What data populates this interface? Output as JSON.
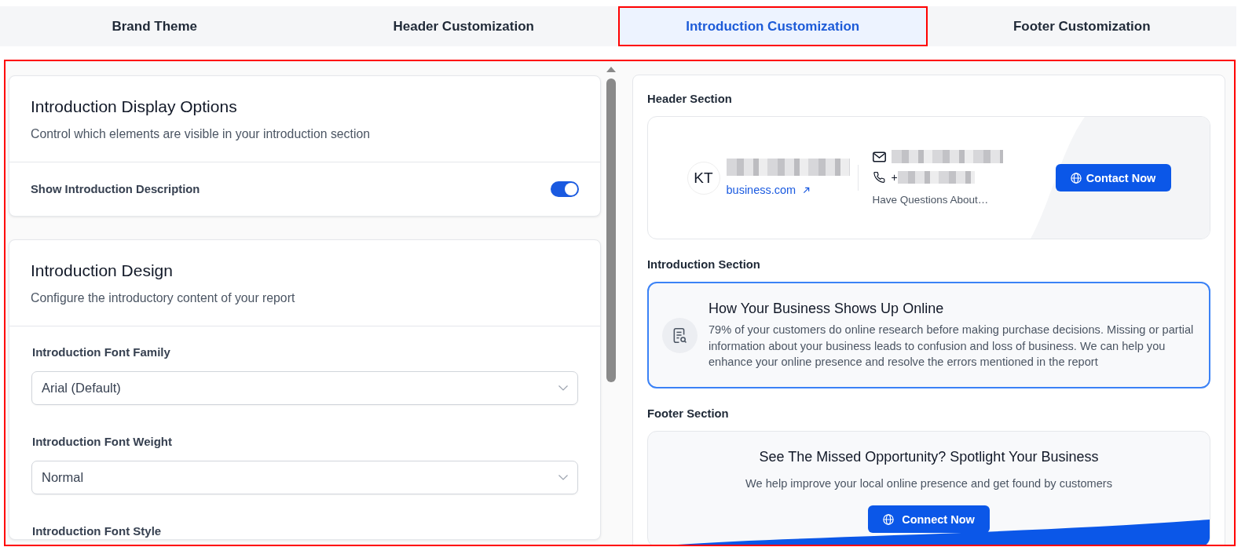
{
  "tabs": [
    {
      "label": "Brand Theme",
      "selected": false
    },
    {
      "label": "Header Customization",
      "selected": false
    },
    {
      "label": "Introduction Customization",
      "selected": true
    },
    {
      "label": "Footer Customization",
      "selected": false
    }
  ],
  "display_options": {
    "title": "Introduction Display Options",
    "subtitle": "Control which elements are visible in your introduction section",
    "toggles": [
      {
        "label": "Show Introduction Description",
        "on": true
      }
    ]
  },
  "design": {
    "title": "Introduction Design",
    "subtitle": "Configure the introductory content of your report",
    "fields": [
      {
        "label": "Introduction Font Family",
        "value": "Arial (Default)"
      },
      {
        "label": "Introduction Font Weight",
        "value": "Normal"
      },
      {
        "label": "Introduction Font Style"
      }
    ]
  },
  "preview": {
    "header_section": {
      "heading": "Header Section",
      "initials": "KT",
      "website": "business.com",
      "phone_prefix": "+",
      "tagline": "Have Questions About…",
      "button": "Contact Now"
    },
    "introduction_section": {
      "heading": "Introduction Section",
      "selected": true,
      "title": "How Your Business Shows Up Online",
      "body": "79% of your customers do online research before making purchase decisions. Missing or partial information about your business leads to confusion and loss of business. We can help you enhance your online presence and resolve the errors mentioned in the report"
    },
    "footer_section": {
      "heading": "Footer Section",
      "title": "See The Missed Opportunity? Spotlight Your Business",
      "subtitle": "We help improve your local online presence and get found by customers",
      "button": "Connect Now"
    }
  }
}
